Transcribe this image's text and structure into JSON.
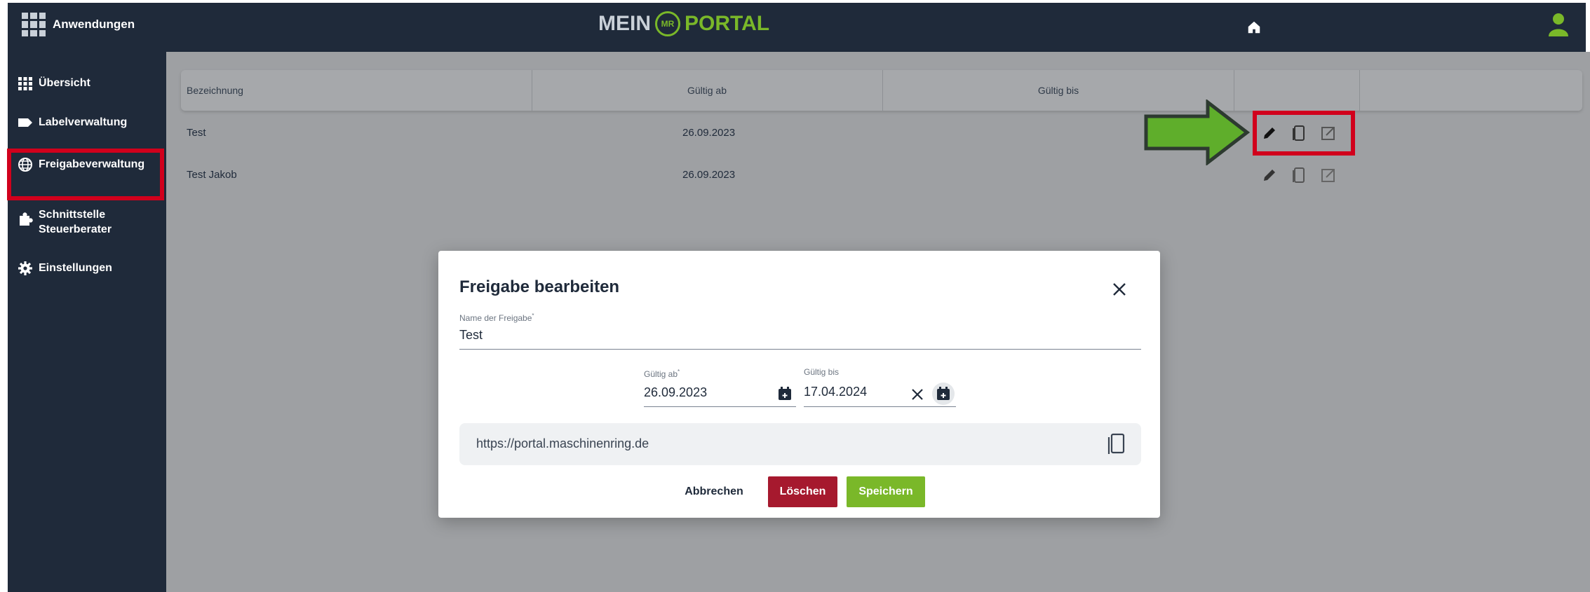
{
  "app": {
    "apps_label": "Anwendungen",
    "logo_left": "MEIN",
    "logo_badge": "MR",
    "logo_right": "PORTAL"
  },
  "sidebar": {
    "items": [
      {
        "label": "Übersicht",
        "icon": "grid-icon"
      },
      {
        "label": "Labelverwaltung",
        "icon": "label-icon"
      },
      {
        "label": "Freigabeverwaltung",
        "icon": "globe-icon"
      },
      {
        "label": "Schnittstelle",
        "label2": "Steuerberater",
        "icon": "puzzle-icon"
      },
      {
        "label": "Einstellungen",
        "icon": "gear-icon"
      }
    ],
    "active": "Freigabeverwaltung"
  },
  "table": {
    "headers": [
      "Bezeichnung",
      "Gültig ab",
      "Gültig bis"
    ],
    "rows": [
      {
        "name": "Test",
        "valid_from": "26.09.2023",
        "valid_to": ""
      },
      {
        "name": "Test Jakob",
        "valid_from": "26.09.2023",
        "valid_to": ""
      }
    ]
  },
  "modal": {
    "title": "Freigabe bearbeiten",
    "name_label": "Name der Freigabe",
    "name_required": "*",
    "name_value": "Test",
    "valid_from_label": "Gültig ab",
    "valid_from_required": "*",
    "valid_from_value": "26.09.2023",
    "valid_to_label": "Gültig bis",
    "valid_to_value": "17.04.2024",
    "url": "https://portal.maschinenring.de",
    "cancel_label": "Abbrechen",
    "delete_label": "Löschen",
    "save_label": "Speichern"
  },
  "colors": {
    "navy": "#1f2a3a",
    "brand_green": "#7ab829",
    "danger_red": "#a6192e",
    "highlight_red": "#d1001c"
  }
}
